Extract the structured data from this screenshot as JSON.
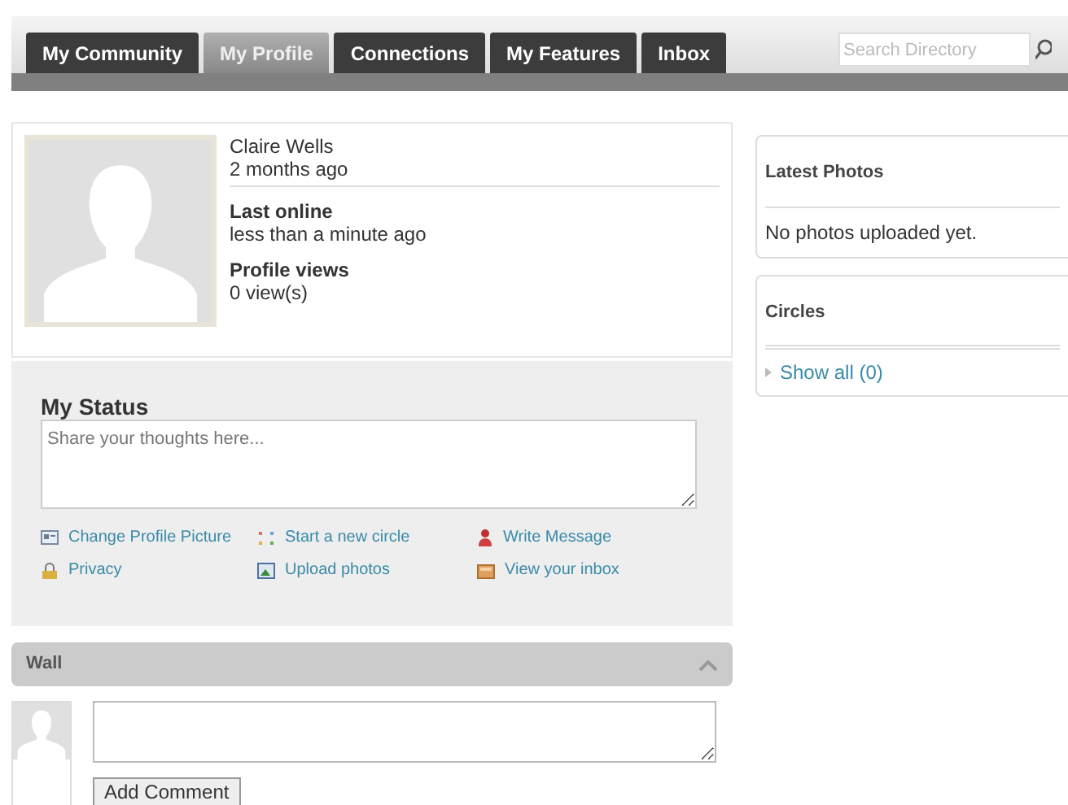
{
  "tabs": [
    {
      "label": "My Community",
      "selected": false
    },
    {
      "label": "My Profile",
      "selected": true
    },
    {
      "label": "Connections",
      "selected": false
    },
    {
      "label": "My Features",
      "selected": false
    },
    {
      "label": "Inbox",
      "selected": false
    }
  ],
  "search": {
    "placeholder": "Search Directory"
  },
  "profile": {
    "name": "Claire Wells",
    "joined": "2 months ago",
    "fields": [
      {
        "label": "Last online",
        "value": "less than a minute ago"
      },
      {
        "label": "Profile views",
        "value": "0 view(s)"
      }
    ]
  },
  "status": {
    "title": "My Status",
    "placeholder": "Share your thoughts here..."
  },
  "actions": [
    {
      "kind": "card",
      "label": "Change Profile Picture"
    },
    {
      "kind": "dots",
      "label": "Start a new circle"
    },
    {
      "kind": "person",
      "label": "Write Message"
    },
    {
      "kind": "lock",
      "label": "Privacy"
    },
    {
      "kind": "photo",
      "label": "Upload photos"
    },
    {
      "kind": "inbox",
      "label": "View your inbox"
    }
  ],
  "wall": {
    "title": "Wall",
    "expanded": true,
    "button": "Add Comment"
  },
  "latest_photos": {
    "title": "Latest Photos",
    "text": "No photos uploaded yet."
  },
  "circles": {
    "title": "Circles",
    "link": "Show all (0)"
  }
}
